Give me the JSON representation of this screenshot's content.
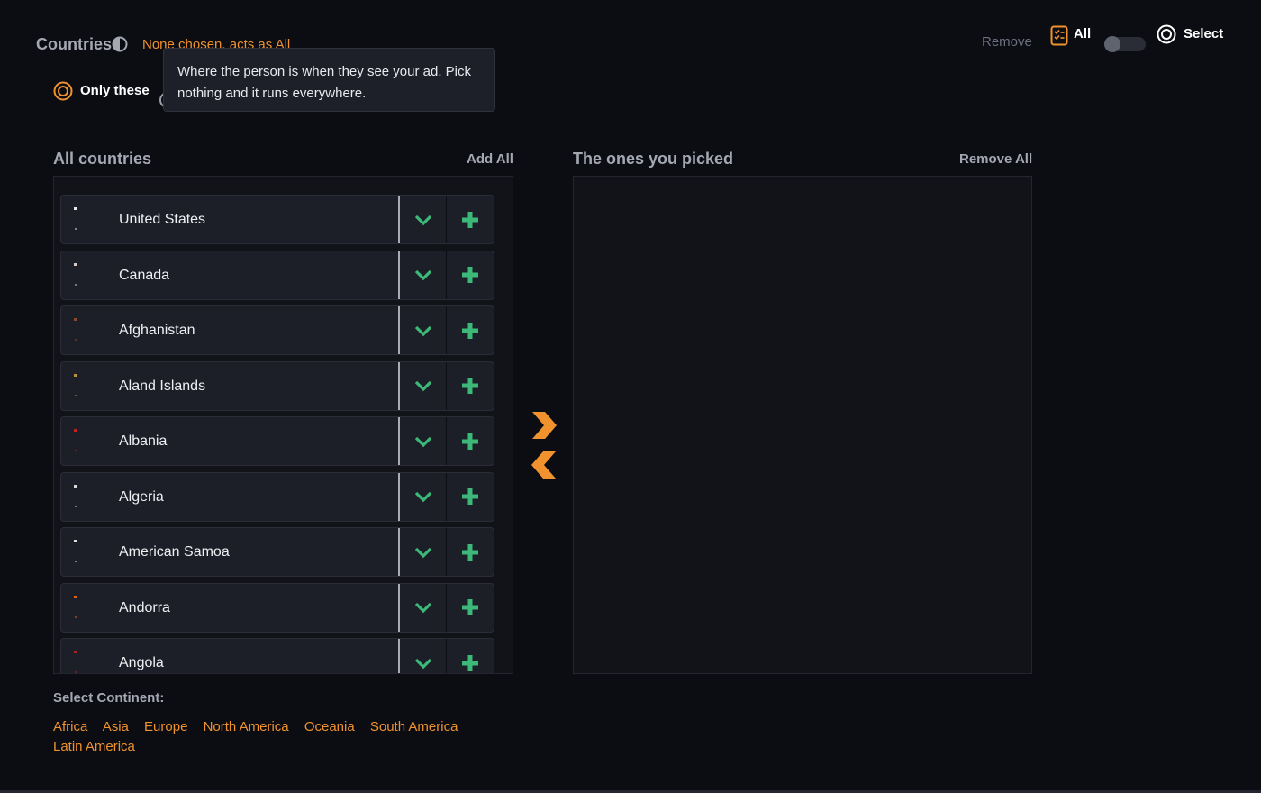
{
  "header": {
    "title": "Countries",
    "status": "None chosen, acts as All",
    "remove_label": "Remove",
    "all_label": "All",
    "select_label": "Select",
    "only_these_label": "Only these",
    "toggle_on": false
  },
  "tooltip": {
    "text": "Where the person is when they see your ad. Pick nothing and it runs everywhere."
  },
  "available": {
    "title": "All countries",
    "add_all_label": "Add All",
    "countries": [
      {
        "name": "United States",
        "flag_color": "#e8e8e8"
      },
      {
        "name": "Canada",
        "flag_color": "#d8c8c8"
      },
      {
        "name": "Afghanistan",
        "flag_color": "#8a4a2a"
      },
      {
        "name": "Aland Islands",
        "flag_color": "#b89040"
      },
      {
        "name": "Albania",
        "flag_color": "#c42020"
      },
      {
        "name": "Algeria",
        "flag_color": "#d8d8d8"
      },
      {
        "name": "American Samoa",
        "flag_color": "#e0e0e0"
      },
      {
        "name": "Andorra",
        "flag_color": "#e0601a"
      },
      {
        "name": "Angola",
        "flag_color": "#b02020"
      }
    ]
  },
  "selected": {
    "title": "The ones you picked",
    "remove_all_label": "Remove All",
    "countries": []
  },
  "continents": {
    "label": "Select Continent:",
    "items": [
      "Africa",
      "Asia",
      "Europe",
      "North America",
      "Oceania",
      "South America",
      "Latin America"
    ]
  },
  "colors": {
    "accent": "#f0922e",
    "action_green": "#3cb878",
    "background": "#0c0d12"
  },
  "icons": {
    "expand": "chevron-down-icon",
    "add": "plus-icon",
    "move_right": "chevron-right-icon",
    "move_left": "chevron-left-icon"
  }
}
